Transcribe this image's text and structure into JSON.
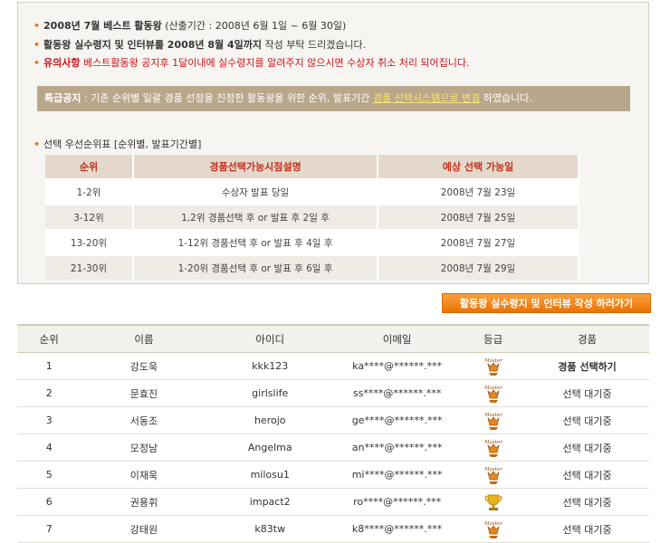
{
  "notice": {
    "line1_bold": "2008년 7월 베스트 활동왕",
    "line1_rest": " (산출기간 : 2008년 6월 1일 ~ 6월 30일)",
    "line2_bold": "활동왕 실수령지 및 인터뷰를 2008년 8월 4일까지",
    "line2_rest": " 작성 부탁 드리겠습니다.",
    "line3_bold": "유의사항",
    "line3_rest": " 베스트활동왕 공지후 1달이내에 실수령지를 알려주지 않으시면 수상자 취소 처리 되어집니다.",
    "special_label": "특급공지",
    "special_text": " : 기존 순위별 일괄 경품 선정을 진정한 활동왕을 위한 순위, 발표기간 ",
    "special_highlight": "경품 선택시스템으로 변경",
    "special_end": " 하였습니다.",
    "priority_title": "선택 우선순위표 [순위별, 발표기간별]"
  },
  "priority_table": {
    "headers": [
      "순위",
      "경품선택가능시점설명",
      "예상 선택 가능일"
    ],
    "rows": [
      [
        "1-2위",
        "수상자 발표 당일",
        "2008년 7월 23일"
      ],
      [
        "3-12위",
        "1,2위 경품선택 후 or 발표 후 2일 후",
        "2008년 7월 25일"
      ],
      [
        "13-20위",
        "1-12위 경품선택 후 or 발표 후 4일 후",
        "2008년 7월 27일"
      ],
      [
        "21-30위",
        "1-20위 경품선택 후 or 발표 후 6일 후",
        "2008년 7월 29일"
      ]
    ]
  },
  "write_button": "활동왕 실수령지 및 인터뷰 작성 하러가기",
  "list": {
    "headers": [
      "순위",
      "이름",
      "아이디",
      "이메일",
      "등급",
      "경품"
    ],
    "badge_text": "Master",
    "rows": [
      {
        "rank": "1",
        "name": "강도욱",
        "id": "kkk123",
        "email": "ka****@******.***",
        "grade": "master",
        "prize": "경품 선택하기"
      },
      {
        "rank": "2",
        "name": "문효진",
        "id": "girlslife",
        "email": "ss****@******.***",
        "grade": "master",
        "prize": "선택 대기중"
      },
      {
        "rank": "3",
        "name": "서동조",
        "id": "herojo",
        "email": "ge****@******.***",
        "grade": "master",
        "prize": "선택 대기중"
      },
      {
        "rank": "4",
        "name": "모정남",
        "id": "Angelma",
        "email": "an****@******.***",
        "grade": "master",
        "prize": "선택 대기중"
      },
      {
        "rank": "5",
        "name": "이재욱",
        "id": "milosu1",
        "email": "mi****@******.***",
        "grade": "master",
        "prize": "선택 대기중"
      },
      {
        "rank": "6",
        "name": "권용휘",
        "id": "impact2",
        "email": "ro****@******.***",
        "grade": "trophy",
        "prize": "선택 대기중"
      },
      {
        "rank": "7",
        "name": "강태원",
        "id": "k83tw",
        "email": "k8****@******.***",
        "grade": "master",
        "prize": "선택 대기중"
      }
    ]
  }
}
